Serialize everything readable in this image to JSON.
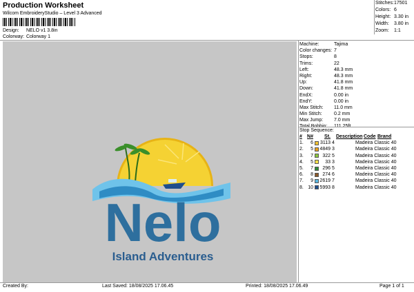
{
  "header": {
    "title": "Production Worksheet",
    "subtitle": "Wilcom EmbroideryStudio – Level 3 Advanced",
    "design_label": "Design:",
    "design_value": "NELO v1 3.8in",
    "colorway_label": "Colorway:",
    "colorway_value": "Colorway 1"
  },
  "stats": [
    {
      "k": "Stitches:",
      "v": "17501"
    },
    {
      "k": "Colors:",
      "v": "6"
    },
    {
      "k": "Height:",
      "v": "3.30 in"
    },
    {
      "k": "Width:",
      "v": "3.80 in"
    },
    {
      "k": "Zoom:",
      "v": "1:1"
    }
  ],
  "machine_info": [
    {
      "k": "Machine:",
      "v": "Tajima"
    },
    {
      "k": "Color changes:",
      "v": "7"
    },
    {
      "k": "Stops:",
      "v": "8"
    },
    {
      "k": "Trims:",
      "v": "22"
    },
    {
      "k": "Left:",
      "v": "48.3 mm"
    },
    {
      "k": "Right:",
      "v": "48.3 mm"
    },
    {
      "k": "Up:",
      "v": "41.8 mm"
    },
    {
      "k": "Down:",
      "v": "41.8 mm"
    },
    {
      "k": "EndX:",
      "v": "0.00 in"
    },
    {
      "k": "EndY:",
      "v": "0.00 in"
    },
    {
      "k": "Max Stitch:",
      "v": "11.0 mm"
    },
    {
      "k": "Min Stitch:",
      "v": "0.2 mm"
    },
    {
      "k": "Max Jump:",
      "v": "7.0 mm"
    },
    {
      "k": "Total Bobbin:",
      "v": "111.25ft"
    }
  ],
  "stop_sequence": {
    "title": "Stop Sequence:",
    "headers": {
      "num": "#",
      "n": "N#",
      "st": "St.",
      "desc": "Description",
      "code": "Code",
      "brand": "Brand"
    },
    "rows": [
      {
        "num": "1.",
        "n": "6",
        "color": "#f1c232",
        "code": "3113",
        "st": "4",
        "brand": "Madeira Classic 40"
      },
      {
        "num": "2.",
        "n": "5",
        "color": "#e8a01c",
        "code": "4849",
        "st": "3",
        "brand": "Madeira Classic 40"
      },
      {
        "num": "3.",
        "n": "7",
        "color": "#8cc63f",
        "code": "322",
        "st": "5",
        "brand": "Madeira Classic 40"
      },
      {
        "num": "4.",
        "n": "5",
        "color": "#f5e04a",
        "code": "33",
        "st": "3",
        "brand": "Madeira Classic 40"
      },
      {
        "num": "5.",
        "n": "7",
        "color": "#2e8b3a",
        "code": "296",
        "st": "5",
        "brand": "Madeira Classic 40"
      },
      {
        "num": "6.",
        "n": "8",
        "color": "#8b5a2b",
        "code": "274",
        "st": "6",
        "brand": "Madeira Classic 40"
      },
      {
        "num": "7.",
        "n": "9",
        "color": "#5bb8e0",
        "code": "2619",
        "st": "7",
        "brand": "Madeira Classic 40"
      },
      {
        "num": "8.",
        "n": "10",
        "color": "#1f4e8c",
        "code": "5993",
        "st": "8",
        "brand": "Madeira Classic 40"
      }
    ]
  },
  "design": {
    "logo_text": "Nelo",
    "tagline": "Island Adventures"
  },
  "footer": {
    "created_by": "Created By:",
    "last_saved": "Last Saved: 18/08/2025 17.06.45",
    "printed": "Printed: 18/08/2025 17.06.49",
    "page": "Page 1 of 1"
  },
  "colors": {
    "canvas_bg": "#c6c6c6",
    "sun": "#f5c518",
    "logo_blue": "#2e6f9e",
    "tagline_blue": "#2a5d8f",
    "wave_light": "#6fc3ea"
  }
}
